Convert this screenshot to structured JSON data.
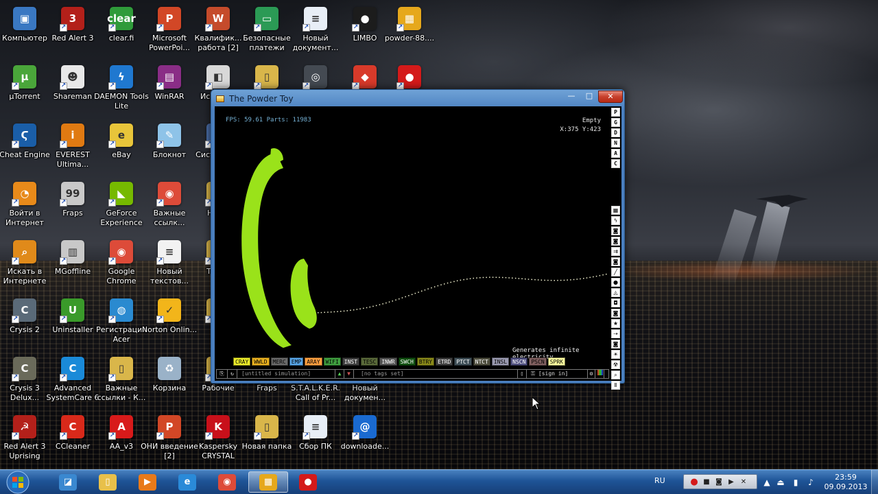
{
  "desktop": {
    "icons": [
      {
        "label": "Компьютер",
        "glyph": "▣",
        "color": "#3a78c2"
      },
      {
        "label": "Red Alert 3",
        "glyph": "3",
        "color": "#b3201a"
      },
      {
        "label": "clear.fi",
        "glyph": "clear",
        "color": "#2f9b3a"
      },
      {
        "label": "Microsoft PowerPoi...",
        "glyph": "P",
        "color": "#d24726"
      },
      {
        "label": "Квалифик... работа [2]",
        "glyph": "W",
        "color": "#c54b2b"
      },
      {
        "label": "Безопасные платежи",
        "glyph": "▭",
        "color": "#2b9a55"
      },
      {
        "label": "Новый документ...",
        "glyph": "≡",
        "color": "#e8eef6"
      },
      {
        "label": "LIMBO",
        "glyph": "●",
        "color": "#1c1c1c"
      },
      {
        "label": "powder-88....",
        "glyph": "▦",
        "color": "#e6a81c"
      },
      {
        "label": "µTorrent",
        "glyph": "µ",
        "color": "#4aa63a"
      },
      {
        "label": "Shareman",
        "glyph": "☻",
        "color": "#e8e8e8"
      },
      {
        "label": "DAEMON Tools Lite",
        "glyph": "ϟ",
        "color": "#1f78d0"
      },
      {
        "label": "WinRAR",
        "glyph": "▤",
        "color": "#8a2d86"
      },
      {
        "label": "Ис... те...",
        "glyph": "◧",
        "color": "#d8d8d8"
      },
      {
        "label": "",
        "glyph": "▯",
        "color": "#d9b64a"
      },
      {
        "label": "",
        "glyph": "◎",
        "color": "#444a52"
      },
      {
        "label": "",
        "glyph": "◆",
        "color": "#d83a2a"
      },
      {
        "label": "",
        "glyph": "●",
        "color": "#d41a1a"
      },
      {
        "label": "Cheat Engine",
        "glyph": "Ϛ",
        "color": "#1a5ea8"
      },
      {
        "label": "EVEREST Ultima...",
        "glyph": "i",
        "color": "#e07a12"
      },
      {
        "label": "eBay",
        "glyph": "e",
        "color": "#e8c53a"
      },
      {
        "label": "Блокнот",
        "glyph": "✎",
        "color": "#8ec3e8"
      },
      {
        "label": "Сист... ан...",
        "glyph": "◫",
        "color": "#4a6ea8"
      },
      {
        "label": "Войти в Интернет",
        "glyph": "◔",
        "color": "#e88a1a"
      },
      {
        "label": "Fraps",
        "glyph": "99",
        "color": "#c9c9c9"
      },
      {
        "label": "GeForce Experience",
        "glyph": "◣",
        "color": "#76b900"
      },
      {
        "label": "Важные ссылк...",
        "glyph": "◉",
        "color": "#dd4b39"
      },
      {
        "label": "Нов...",
        "glyph": "▯",
        "color": "#d9b64a"
      },
      {
        "label": "Искать в Интернете",
        "glyph": "⌕",
        "color": "#e08a1a"
      },
      {
        "label": "MGoffline",
        "glyph": "▥",
        "color": "#c8c8c8"
      },
      {
        "label": "Google Chrome",
        "glyph": "◉",
        "color": "#dd4b39"
      },
      {
        "label": "Новый текстов...",
        "glyph": "≡",
        "color": "#f2f2f2"
      },
      {
        "label": "Таж...",
        "glyph": "▯",
        "color": "#d9b64a"
      },
      {
        "label": "Crysis 2",
        "glyph": "C",
        "color": "#5a6a78"
      },
      {
        "label": "Uninstaller",
        "glyph": "U",
        "color": "#3a9a2a"
      },
      {
        "label": "Регистрация Acer",
        "glyph": "◍",
        "color": "#2a8ad0"
      },
      {
        "label": "Norton Onlin...",
        "glyph": "✓",
        "color": "#f2b51a"
      },
      {
        "label": "S...",
        "glyph": "▯",
        "color": "#d9b64a"
      },
      {
        "label": "Crysis 3 Delux...",
        "glyph": "C",
        "color": "#6a6a5a"
      },
      {
        "label": "Advanced SystemCare 6",
        "glyph": "C",
        "color": "#1a8ad8"
      },
      {
        "label": "Важные ссылки - К...",
        "glyph": "▯",
        "color": "#d9b64a"
      },
      {
        "label": "Корзина",
        "glyph": "♻",
        "color": "#9ab2c8"
      },
      {
        "label": "Рабочие",
        "glyph": "▯",
        "color": "#d9b64a"
      },
      {
        "label": "Fraps",
        "glyph": "",
        "color": "transparent"
      },
      {
        "label": "S.T.A.L.K.E.R. Call of Pr...",
        "glyph": "",
        "color": "transparent"
      },
      {
        "label": "Новый докумен...",
        "glyph": "",
        "color": "transparent"
      },
      {
        "label": "Red Alert 3 Uprising",
        "glyph": "☭",
        "color": "#b3201a"
      },
      {
        "label": "CCleaner",
        "glyph": "C",
        "color": "#d8291a"
      },
      {
        "label": "AA_v3",
        "glyph": "A",
        "color": "#d81a1a"
      },
      {
        "label": "ОНИ введение [2]",
        "glyph": "P",
        "color": "#d24726"
      },
      {
        "label": "Kaspersky CRYSTAL",
        "glyph": "K",
        "color": "#c8101a"
      },
      {
        "label": "Новая папка",
        "glyph": "▯",
        "color": "#d9b64a"
      },
      {
        "label": "Сбор ПК",
        "glyph": "≡",
        "color": "#e8eef6"
      },
      {
        "label": "downloade...",
        "glyph": "@",
        "color": "#1a6ad0"
      }
    ]
  },
  "window": {
    "title": "The Powder Toy",
    "controls": {
      "minimize": "—",
      "maximize": "□",
      "close": "✕"
    }
  },
  "sim": {
    "fps_text": "FPS: 59.61 Parts: 11983",
    "hover_element": "Empty",
    "hover_coords": "X:375 Y:423",
    "element_description": "Generates infinite electricity.",
    "mode_buttons": [
      "P",
      "G",
      "D",
      "N",
      "A",
      "C"
    ],
    "menu_icons": [
      "▦",
      "ϟ",
      "◙",
      "◙",
      "⇉",
      "◙",
      "╱",
      "●",
      "◬",
      "◘",
      "◙",
      "★",
      "⇢",
      "◙",
      "☀",
      "☢",
      "⌕",
      "Ⅱ"
    ],
    "elements": [
      {
        "name": "CRAY",
        "bg": "#ecec2a",
        "fg": "#000"
      },
      {
        "name": "WWLD",
        "bg": "#e8b020",
        "fg": "#000"
      },
      {
        "name": "MERC",
        "bg": "#6a6a6a",
        "fg": "#000"
      },
      {
        "name": "EMP",
        "bg": "#58a6e8",
        "fg": "#000"
      },
      {
        "name": "ARAY",
        "bg": "#ffa040",
        "fg": "#000"
      },
      {
        "name": "WIFI",
        "bg": "#40a040",
        "fg": "#000"
      },
      {
        "name": "INST",
        "bg": "#404040",
        "fg": "#fff"
      },
      {
        "name": "TESC",
        "bg": "#5a6a3a",
        "fg": "#000"
      },
      {
        "name": "INWR",
        "bg": "#545454",
        "fg": "#fff"
      },
      {
        "name": "SWCH",
        "bg": "#105010",
        "fg": "#fff"
      },
      {
        "name": "BTRY",
        "bg": "#8a8a1a",
        "fg": "#000"
      },
      {
        "name": "ETRD",
        "bg": "#404040",
        "fg": "#fff"
      },
      {
        "name": "PTCT",
        "bg": "#405058",
        "fg": "#fff"
      },
      {
        "name": "NTCT",
        "bg": "#505040",
        "fg": "#fff"
      },
      {
        "name": "INSL",
        "bg": "#9a9ab0",
        "fg": "#000"
      },
      {
        "name": "NSCN",
        "bg": "#505080",
        "fg": "#fff"
      },
      {
        "name": "PSCN",
        "bg": "#806060",
        "fg": "#000"
      },
      {
        "name": "SPRK",
        "bg": "#ffffa0",
        "fg": "#000"
      }
    ],
    "bottom_bar": {
      "save_name": "[untitled simulation]",
      "tags": "[no tags set]",
      "sign_in": "[sign in]"
    }
  },
  "taskbar": {
    "buttons": [
      {
        "name": "control-panel",
        "glyph": "◪",
        "color": "#3a88d0"
      },
      {
        "name": "explorer",
        "glyph": "▯",
        "color": "#e8c04a"
      },
      {
        "name": "media-player",
        "glyph": "▶",
        "color": "#e87a1a"
      },
      {
        "name": "internet-explorer",
        "glyph": "e",
        "color": "#2a8ad8"
      },
      {
        "name": "chrome",
        "glyph": "◉",
        "color": "#dd4b39"
      },
      {
        "name": "powder-toy",
        "glyph": "▦",
        "color": "#e6a81c"
      },
      {
        "name": "recorder",
        "glyph": "●",
        "color": "#d41a1a"
      }
    ],
    "language": "RU",
    "time": "23:59",
    "date": "09.09.2013"
  }
}
